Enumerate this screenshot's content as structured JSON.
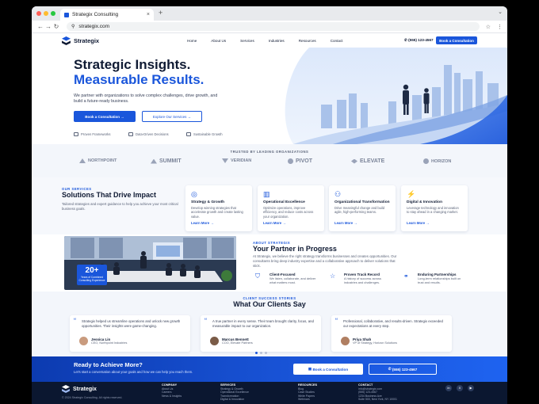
{
  "browser": {
    "tab_title": "Strategix Consulting",
    "url": "strategix.com"
  },
  "site": {
    "brand": "Strategix",
    "nav": [
      "Home",
      "About Us",
      "Services",
      "Industries",
      "Resources",
      "Contact"
    ],
    "phone": "(555) 123-4567",
    "header_cta": "Book a Consultation"
  },
  "hero": {
    "title_line1": "Strategic Insights.",
    "title_line2": "Measurable Results.",
    "subtitle": "We partner with organizations to solve complex challenges, drive growth, and build a future-ready business.",
    "primary_cta": "Book a Consultation",
    "secondary_cta": "Explore Our Services",
    "features": [
      "Proven Frameworks",
      "Data-Driven Decisions",
      "Sustainable Growth"
    ]
  },
  "trusted": {
    "heading": "TRUSTED BY LEADING ORGANIZATIONS",
    "brands": [
      "NORTHPOINT",
      "SUMMIT",
      "VERIDIAN",
      "PIVOT",
      "ELEVATE",
      "HORIZON"
    ]
  },
  "services": {
    "eyebrow": "OUR SERVICES",
    "title": "Solutions That Drive Impact",
    "description": "Tailored strategies and expert guidance to help you achieve your most critical business goals.",
    "cards": [
      {
        "title": "Strategy & Growth",
        "desc": "Develop winning strategies that accelerate growth and create lasting value.",
        "link": "Learn More"
      },
      {
        "title": "Operational Excellence",
        "desc": "Optimize operations, improve efficiency, and reduce costs across your organization.",
        "link": "Learn More"
      },
      {
        "title": "Organizational Transformation",
        "desc": "Drive meaningful change and build agile, high-performing teams.",
        "link": "Learn More"
      },
      {
        "title": "Digital & Innovation",
        "desc": "Leverage technology and innovation to stay ahead in a changing market.",
        "link": "Learn More"
      }
    ]
  },
  "about": {
    "badge_number": "20+",
    "badge_label": "Years of Combined Consulting Experience",
    "eyebrow": "ABOUT STRATEGIX",
    "title": "Your Partner in Progress",
    "text": "At Strategix, we believe the right strategy transforms businesses and creates opportunities. Our consultants bring deep industry expertise and a collaborative approach to deliver solutions that stick.",
    "pillars": [
      {
        "title": "Client-Focused",
        "desc": "We listen, collaborate, and deliver what matters most."
      },
      {
        "title": "Proven Track Record",
        "desc": "A history of success across industries and challenges."
      },
      {
        "title": "Enduring Partnerships",
        "desc": "Long-term relationships built on trust and results."
      }
    ]
  },
  "testimonials": {
    "eyebrow": "CLIENT SUCCESS STORIES",
    "title": "What Our Clients Say",
    "items": [
      {
        "quote": "Strategix helped us streamline operations and unlock new growth opportunities. Their insights were game-changing.",
        "name": "Jessica Lin",
        "role": "CEO, Northpoint Industries"
      },
      {
        "quote": "A true partner in every sense. Their team brought clarity, focus, and measurable impact to our organization.",
        "name": "Marcus Bennett",
        "role": "COO, Elevate Partners"
      },
      {
        "quote": "Professional, collaborative, and results-driven. Strategix exceeded our expectations at every step.",
        "name": "Priya Shah",
        "role": "VP of Strategy, Horizon Solutions"
      }
    ]
  },
  "cta": {
    "title": "Ready to Achieve More?",
    "text": "Let's start a conversation about your goals and how we can help you reach them.",
    "primary": "Book a Consultation",
    "secondary": "(555) 123-4567"
  },
  "footer": {
    "brand": "Strategix",
    "copyright": "© 2024 Strategix Consulting. All rights reserved.",
    "columns": [
      {
        "heading": "COMPANY",
        "links": [
          "About Us",
          "Careers",
          "News & Insights"
        ]
      },
      {
        "heading": "SERVICES",
        "links": [
          "Strategy & Growth",
          "Operational Excellence",
          "Transformation",
          "Digital & Innovation"
        ]
      },
      {
        "heading": "RESOURCES",
        "links": [
          "Blog",
          "Case Studies",
          "White Papers",
          "Webinars"
        ]
      },
      {
        "heading": "CONTACT",
        "links": [
          "info@strategix.com",
          "(555) 123-4567",
          "1234 Business Ave",
          "Suite 500, New York, NY 10001"
        ]
      }
    ]
  }
}
